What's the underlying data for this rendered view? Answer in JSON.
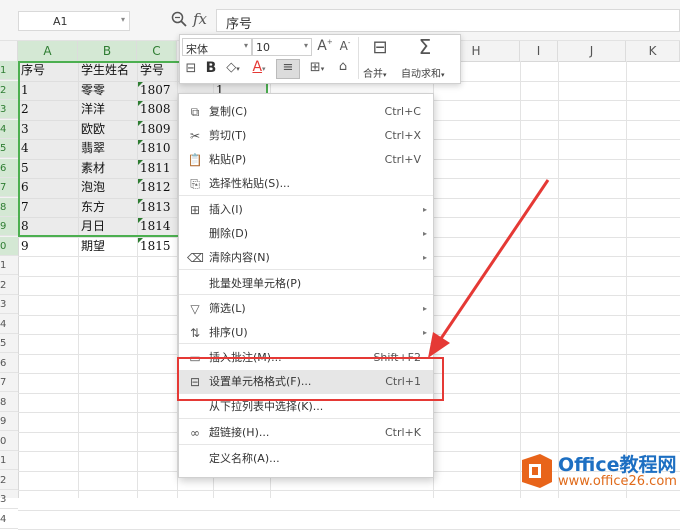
{
  "formula_bar": {
    "cell_ref": "A1",
    "fx_label": "fx",
    "content": "序号"
  },
  "columns": [
    "A",
    "B",
    "C",
    "D",
    "E",
    "F",
    "G",
    "H",
    "I",
    "J",
    "K"
  ],
  "rows": [
    "1",
    "2",
    "3",
    "4",
    "5",
    "6",
    "7",
    "8",
    "9",
    "0",
    "1",
    "2",
    "3",
    "4",
    "5",
    "6",
    "7",
    "8",
    "9",
    "0",
    "1",
    "2",
    "3",
    "4"
  ],
  "table": {
    "header": [
      "序号",
      "学生姓名",
      "学号"
    ],
    "rows": [
      [
        "1",
        "零零",
        "1807"
      ],
      [
        "2",
        "洋洋",
        "1808"
      ],
      [
        "3",
        "欧欧",
        "1809"
      ],
      [
        "4",
        "翡翠",
        "1810"
      ],
      [
        "5",
        "素材",
        "1811"
      ],
      [
        "6",
        "泡泡",
        "1812"
      ],
      [
        "7",
        "东方",
        "1813"
      ],
      [
        "8",
        "月日",
        "1814"
      ],
      [
        "9",
        "期望",
        "1815"
      ]
    ],
    "d2_value": "1"
  },
  "mini_toolbar": {
    "font_name": "宋体",
    "font_size": "10",
    "bold": "B",
    "font_color": "A",
    "merge_label": "合并",
    "autosum_label": "自动求和"
  },
  "context_menu": {
    "items": [
      {
        "icon": "copy-icon",
        "label": "复制(C)",
        "shortcut": "Ctrl+C"
      },
      {
        "icon": "cut-icon",
        "label": "剪切(T)",
        "shortcut": "Ctrl+X"
      },
      {
        "icon": "paste-icon",
        "label": "粘贴(P)",
        "shortcut": "Ctrl+V"
      },
      {
        "icon": "paste-special-icon",
        "label": "选择性粘贴(S)...",
        "shortcut": ""
      },
      {
        "icon": "insert-icon",
        "label": "插入(I)",
        "shortcut": ""
      },
      {
        "icon": "",
        "label": "删除(D)",
        "shortcut": ""
      },
      {
        "icon": "eraser-icon",
        "label": "清除内容(N)",
        "shortcut": ""
      },
      {
        "icon": "",
        "label": "批量处理单元格(P)",
        "shortcut": ""
      },
      {
        "icon": "filter-icon",
        "label": "筛选(L)",
        "shortcut": ""
      },
      {
        "icon": "sort-icon",
        "label": "排序(U)",
        "shortcut": ""
      },
      {
        "icon": "comment-icon",
        "label": "插入批注(M)...",
        "shortcut": "Shift+F2"
      },
      {
        "icon": "format-cells-icon",
        "label": "设置单元格格式(F)...",
        "shortcut": "Ctrl+1"
      },
      {
        "icon": "",
        "label": "从下拉列表中选择(K)...",
        "shortcut": ""
      },
      {
        "icon": "link-icon",
        "label": "超链接(H)...",
        "shortcut": "Ctrl+K"
      },
      {
        "icon": "",
        "label": "定义名称(A)...",
        "shortcut": ""
      }
    ]
  },
  "watermark": {
    "title": "Office教程网",
    "url": "www.office26.com"
  },
  "colors": {
    "selection_border": "#4caf50",
    "highlight_box": "#e53935",
    "arrow": "#e53935"
  }
}
